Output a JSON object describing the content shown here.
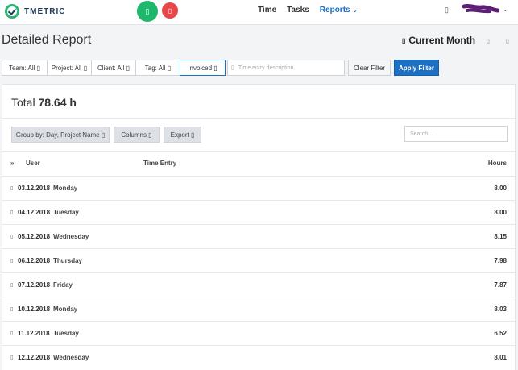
{
  "app": {
    "name": "TMETRIC"
  },
  "timer": {
    "start_icon": "play-icon",
    "stop_icon": "stop-icon"
  },
  "nav": {
    "items": [
      {
        "label": "Time",
        "active": false
      },
      {
        "label": "Tasks",
        "active": false
      },
      {
        "label": "Reports",
        "active": true
      }
    ]
  },
  "header": {
    "title": "Detailed Report",
    "period": "Current Month"
  },
  "filters": {
    "buttons": [
      {
        "key": "team",
        "label": "Team: All ▯"
      },
      {
        "key": "project",
        "label": "Project: All ▯"
      },
      {
        "key": "client",
        "label": "Client: All ▯"
      },
      {
        "key": "tag",
        "label": "Tag: All ▯"
      },
      {
        "key": "invoiced",
        "label": "Invoiced ▯"
      }
    ],
    "description_placeholder": "Time entry description",
    "clear_label": "Clear Filter",
    "apply_label": "Apply Filter"
  },
  "report": {
    "total_label": "Total",
    "total_value": "78.64 h",
    "group_by_label": "Group by: Day, Project Name ▯",
    "columns_label": "Columns ▯",
    "export_label": "Export ▯",
    "search_placeholder": "Search...",
    "columns": {
      "user": "User",
      "time_entry": "Time Entry",
      "hours": "Hours"
    },
    "rows": [
      {
        "date": "03.12.2018",
        "day": "Monday",
        "hours": "8.00"
      },
      {
        "date": "04.12.2018",
        "day": "Tuesday",
        "hours": "8.00"
      },
      {
        "date": "05.12.2018",
        "day": "Wednesday",
        "hours": "8.15"
      },
      {
        "date": "06.12.2018",
        "day": "Thursday",
        "hours": "7.98"
      },
      {
        "date": "07.12.2018",
        "day": "Friday",
        "hours": "7.87"
      },
      {
        "date": "10.12.2018",
        "day": "Monday",
        "hours": "8.03"
      },
      {
        "date": "11.12.2018",
        "day": "Tuesday",
        "hours": "6.52"
      },
      {
        "date": "12.12.2018",
        "day": "Wednesday",
        "hours": "8.01"
      }
    ]
  },
  "colors": {
    "accent": "#1b6fc4",
    "start": "#1eb76b",
    "stop": "#e8474a"
  }
}
